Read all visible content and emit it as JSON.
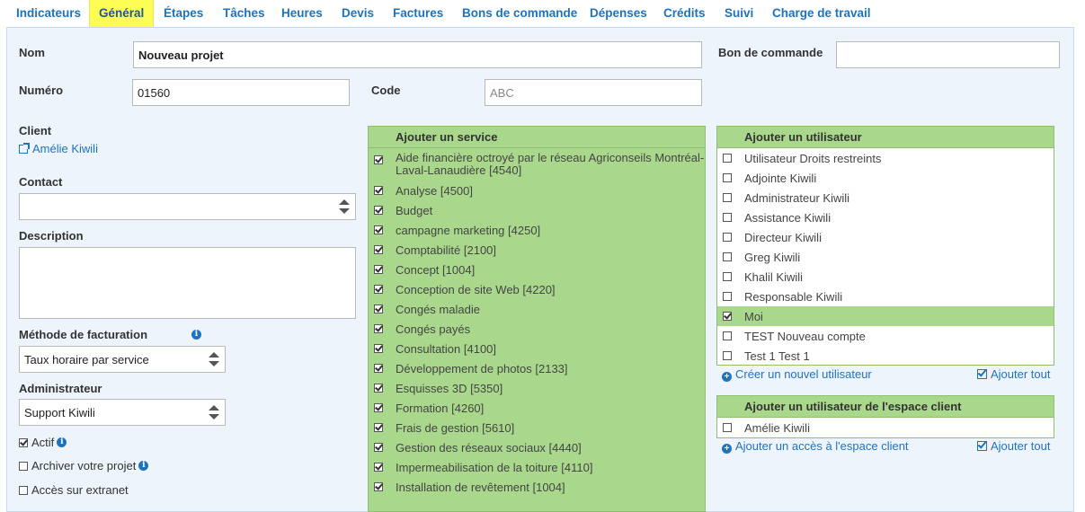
{
  "tabs": [
    "Indicateurs",
    "Général",
    "Étapes",
    "Tâches",
    "Heures",
    "Devis",
    "Factures",
    "Bons de commande",
    "Dépenses",
    "Crédits",
    "Suivi",
    "Charge de travail"
  ],
  "active_tab": "Général",
  "form": {
    "nom_label": "Nom",
    "nom_value": "Nouveau projet",
    "bon_label": "Bon de commande",
    "bon_value": "",
    "numero_label": "Numéro",
    "numero_value": "01560",
    "code_label": "Code",
    "code_placeholder": "ABC",
    "client_label": "Client",
    "client_value": "Amélie Kiwili",
    "contact_label": "Contact",
    "contact_value": "",
    "description_label": "Description",
    "description_value": "",
    "methode_label": "Méthode de facturation",
    "methode_value": "Taux horaire par service",
    "admin_label": "Administrateur",
    "admin_value": "Support Kiwili",
    "actif_label": "Actif",
    "actif_checked": true,
    "archiver_label": "Archiver votre projet",
    "archiver_checked": false,
    "extranet_label": "Accès sur extranet",
    "extranet_checked": false
  },
  "services": {
    "title": "Ajouter un service",
    "items": [
      {
        "label": "Aide financière octroyé par le réseau Agriconseils Montréal-Laval-Lanaudière [4540]",
        "checked": true
      },
      {
        "label": "Analyse [4500]",
        "checked": true
      },
      {
        "label": "Budget",
        "checked": true
      },
      {
        "label": "campagne marketing [4250]",
        "checked": true
      },
      {
        "label": "Comptabilité [2100]",
        "checked": true
      },
      {
        "label": "Concept [1004]",
        "checked": true
      },
      {
        "label": "Conception de site Web [4220]",
        "checked": true
      },
      {
        "label": "Congés maladie",
        "checked": true
      },
      {
        "label": "Congés payés",
        "checked": true
      },
      {
        "label": "Consultation [4100]",
        "checked": true
      },
      {
        "label": "Développement de photos [2133]",
        "checked": true
      },
      {
        "label": "Esquisses 3D [5350]",
        "checked": true
      },
      {
        "label": "Formation [4260]",
        "checked": true
      },
      {
        "label": "Frais de gestion [5610]",
        "checked": true
      },
      {
        "label": "Gestion des réseaux sociaux [4440]",
        "checked": true
      },
      {
        "label": "Impermeabilisation de la toiture [4110]",
        "checked": true
      },
      {
        "label": "Installation de revêtement [1004]",
        "checked": true
      }
    ]
  },
  "users": {
    "title": "Ajouter un utilisateur",
    "items": [
      {
        "label": "Utilisateur Droits restreints",
        "checked": false
      },
      {
        "label": "Adjointe Kiwili",
        "checked": false
      },
      {
        "label": "Administrateur Kiwili",
        "checked": false
      },
      {
        "label": "Assistance Kiwili",
        "checked": false
      },
      {
        "label": "Directeur Kiwili",
        "checked": false
      },
      {
        "label": "Greg Kiwili",
        "checked": false
      },
      {
        "label": "Khalil Kiwili",
        "checked": false
      },
      {
        "label": "Responsable Kiwili",
        "checked": false
      },
      {
        "label": "Moi",
        "checked": true
      },
      {
        "label": "TEST Nouveau compte",
        "checked": false
      },
      {
        "label": "Test 1 Test 1",
        "checked": false
      }
    ],
    "create_link": "Créer un nouvel utilisateur",
    "add_all": "Ajouter tout"
  },
  "client_users": {
    "title": "Ajouter un utilisateur de l'espace client",
    "items": [
      {
        "label": "Amélie Kiwili",
        "checked": false
      }
    ],
    "add_access_link": "Ajouter un accès à l'espace client",
    "add_all": "Ajouter tout"
  }
}
